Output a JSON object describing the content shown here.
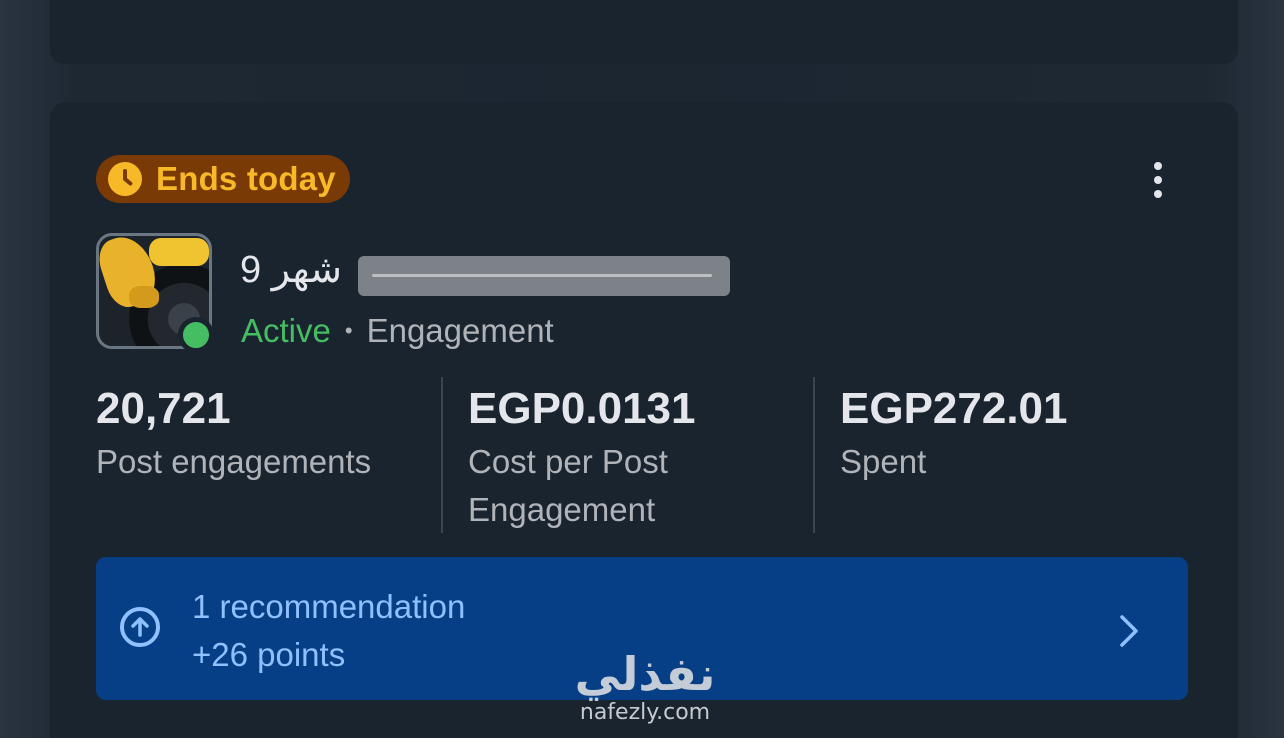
{
  "card": {
    "badge": {
      "text": "Ends today",
      "icon": "clock-icon",
      "color": "#f7b928",
      "background": "#7a3a05"
    },
    "more_icon": "three-dots-vertical-icon",
    "ad": {
      "title": "9 شهر",
      "status": "Active",
      "status_color": "#45bd62",
      "separator": "•",
      "objective": "Engagement"
    },
    "metrics": [
      {
        "value": "20,721",
        "label": "Post engagements"
      },
      {
        "value": "EGP0.0131",
        "label": "Cost per Post Engagement"
      },
      {
        "value": "EGP272.01",
        "label": "Spent"
      }
    ],
    "recommendation": {
      "title": "1 recommendation",
      "points": "+26 points",
      "icon": "arrow-up-circle-icon",
      "chevron": "chevron-right-icon",
      "background": "#073f86",
      "text_color": "#8fc0ff"
    }
  },
  "watermark": {
    "arabic": "نفذلي",
    "site": "nafezly.com"
  }
}
